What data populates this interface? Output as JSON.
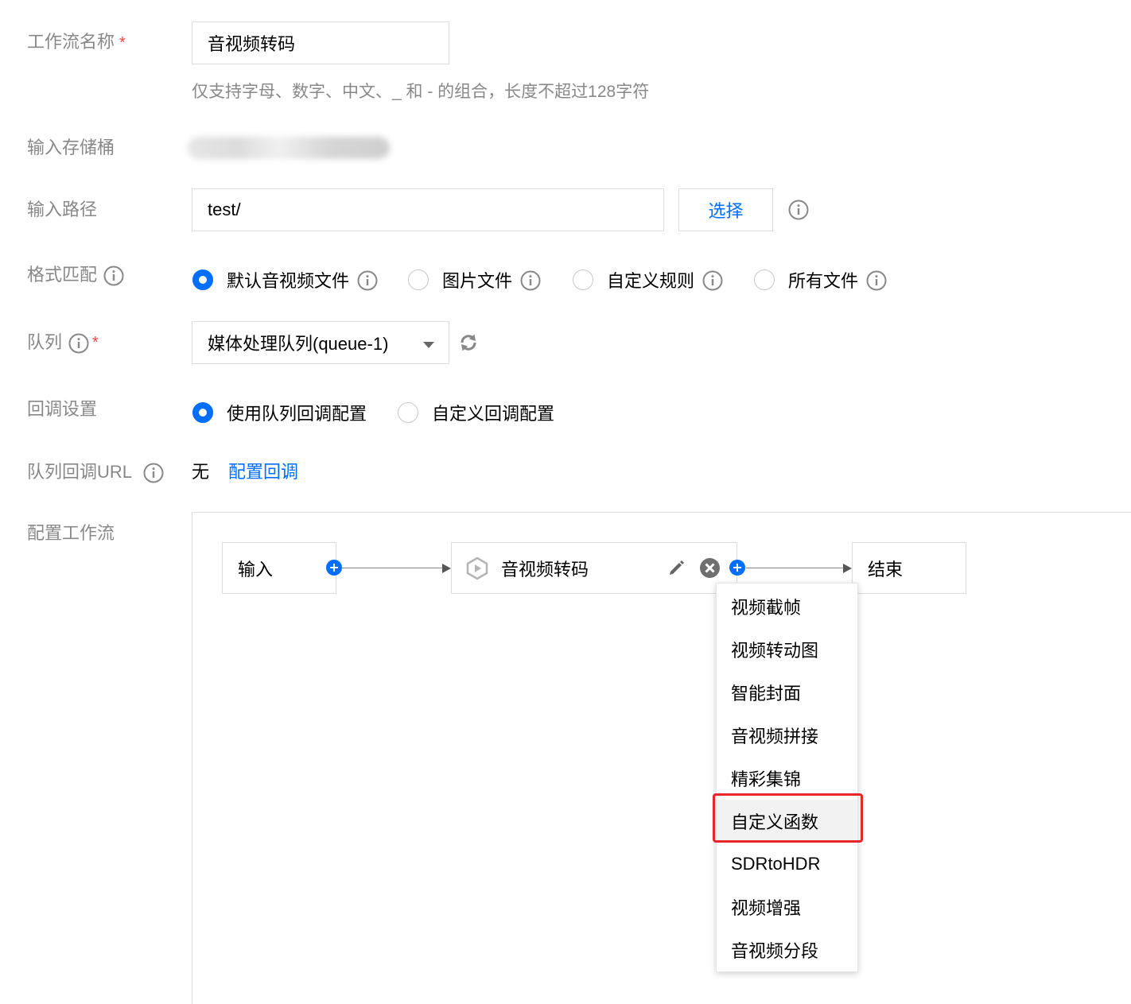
{
  "form": {
    "name": {
      "label": "工作流名称",
      "required_mark": "*",
      "value": "音视频转码",
      "hint": "仅支持字母、数字、中文、_ 和 - 的组合，长度不超过128字符"
    },
    "bucket": {
      "label": "输入存储桶"
    },
    "path": {
      "label": "输入路径",
      "value": "test/",
      "select_button": "选择"
    },
    "format": {
      "label": "格式匹配",
      "options": [
        {
          "label": "默认音视频文件",
          "selected": true
        },
        {
          "label": "图片文件",
          "selected": false
        },
        {
          "label": "自定义规则",
          "selected": false
        },
        {
          "label": "所有文件",
          "selected": false
        }
      ]
    },
    "queue": {
      "label": "队列",
      "required_mark": "*",
      "value": "媒体处理队列(queue-1)"
    },
    "callback": {
      "label": "回调设置",
      "options": [
        {
          "label": "使用队列回调配置",
          "selected": true
        },
        {
          "label": "自定义回调配置",
          "selected": false
        }
      ]
    },
    "callback_url": {
      "label": "队列回调URL",
      "value": "无",
      "link": "配置回调"
    },
    "workflow": {
      "label": "配置工作流"
    }
  },
  "workflow": {
    "nodes": {
      "input": "输入",
      "transcode": "音视频转码",
      "end": "结束"
    }
  },
  "menu": {
    "items": [
      "视频截帧",
      "视频转动图",
      "智能封面",
      "音视频拼接",
      "精彩集锦",
      "自定义函数",
      "SDRtoHDR",
      "视频增强",
      "音视频分段"
    ],
    "highlighted": "自定义函数"
  },
  "colors": {
    "accent": "#006eff",
    "highlight": "#e8262a",
    "label": "#888888"
  }
}
